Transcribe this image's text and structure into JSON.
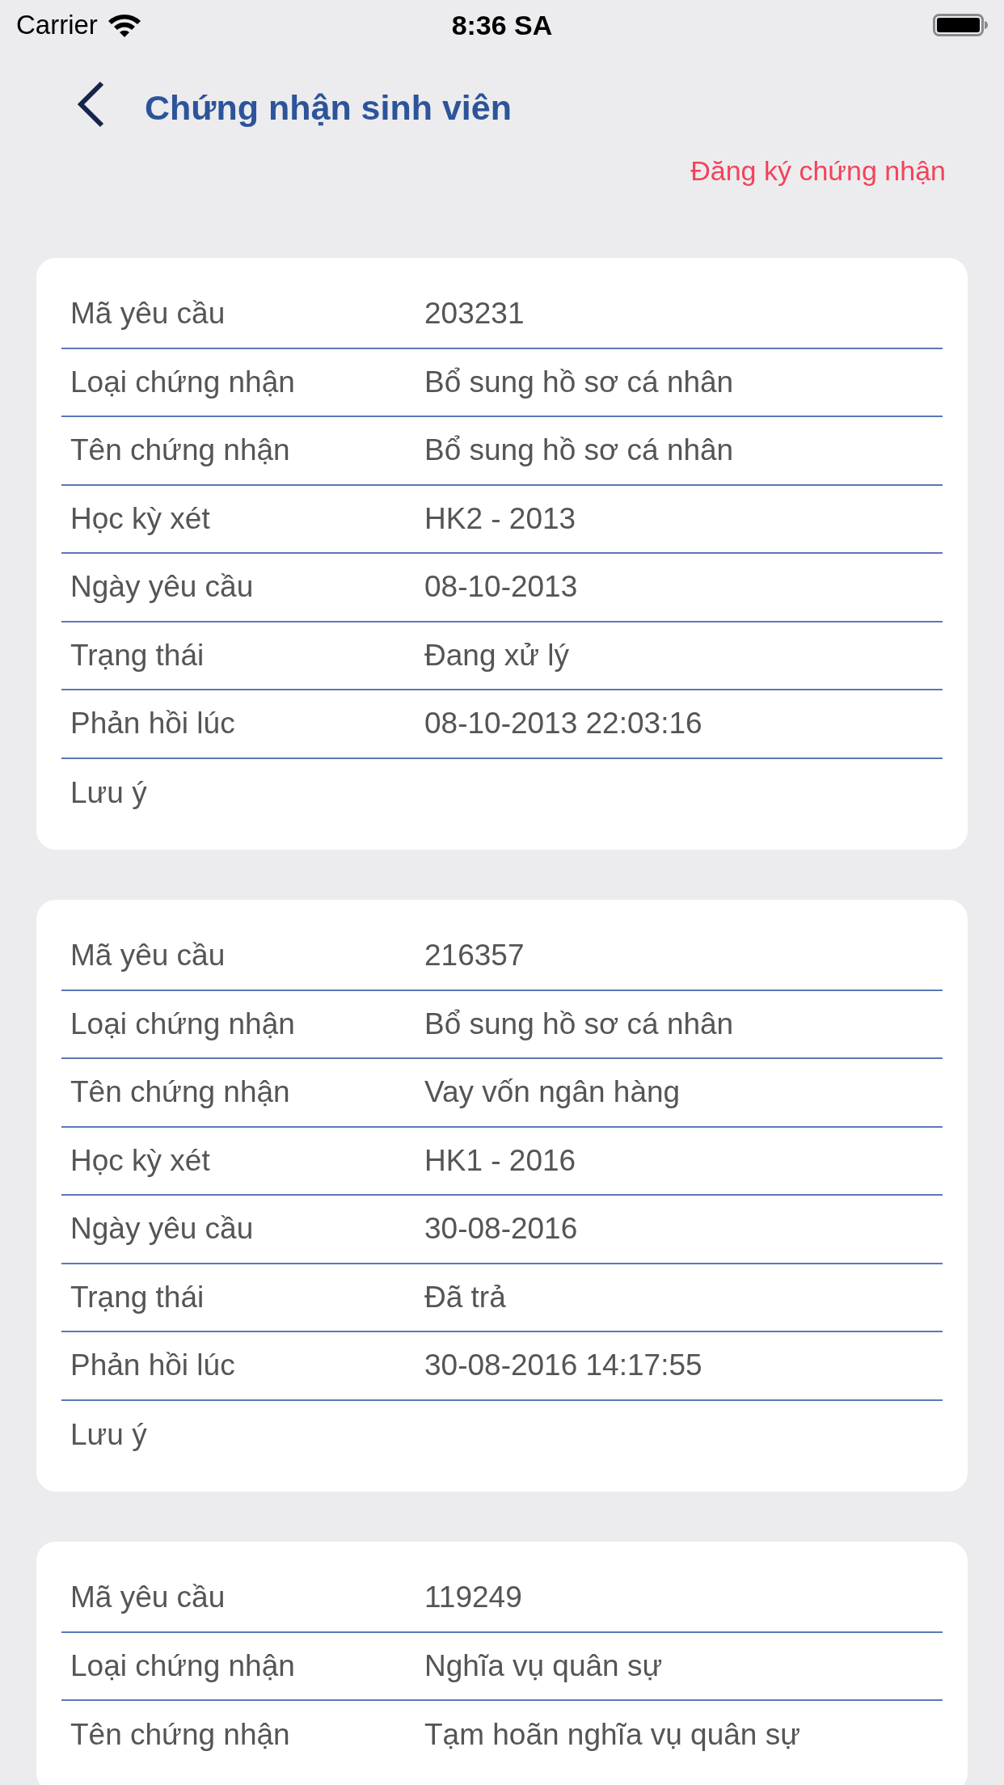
{
  "status_bar": {
    "carrier": "Carrier",
    "time": "8:36 SA"
  },
  "header": {
    "title": "Chứng nhận sinh viên"
  },
  "register_link": "Đăng ký chứng nhận",
  "requests": [
    {
      "fields": [
        {
          "label": "Mã yêu cầu",
          "value": "203231"
        },
        {
          "label": "Loại chứng nhận",
          "value": "Bổ sung hồ sơ cá nhân"
        },
        {
          "label": "Tên chứng nhận",
          "value": "Bổ sung hồ sơ cá nhân"
        },
        {
          "label": "Học kỳ xét",
          "value": "HK2 - 2013"
        },
        {
          "label": "Ngày yêu cầu",
          "value": "08-10-2013"
        },
        {
          "label": "Trạng thái",
          "value": "Đang xử lý"
        },
        {
          "label": "Phản hồi lúc",
          "value": "08-10-2013 22:03:16"
        },
        {
          "label": "Lưu ý"
        }
      ]
    },
    {
      "fields": [
        {
          "label": "Mã yêu cầu",
          "value": "216357"
        },
        {
          "label": "Loại chứng nhận",
          "value": "Bổ sung hồ sơ cá nhân"
        },
        {
          "label": "Tên chứng nhận",
          "value": "Vay vốn ngân hàng"
        },
        {
          "label": "Học kỳ xét",
          "value": "HK1 - 2016"
        },
        {
          "label": "Ngày yêu cầu",
          "value": "30-08-2016"
        },
        {
          "label": "Trạng thái",
          "value": "Đã trả"
        },
        {
          "label": "Phản hồi lúc",
          "value": "30-08-2016 14:17:55"
        },
        {
          "label": "Lưu ý"
        }
      ]
    },
    {
      "fields": [
        {
          "label": "Mã yêu cầu",
          "value": "119249"
        },
        {
          "label": "Loại chứng nhận",
          "value": "Nghĩa vụ quân sự"
        },
        {
          "label": "Tên chứng nhận",
          "value": "Tạm hoãn nghĩa vụ quân sự"
        }
      ]
    }
  ]
}
